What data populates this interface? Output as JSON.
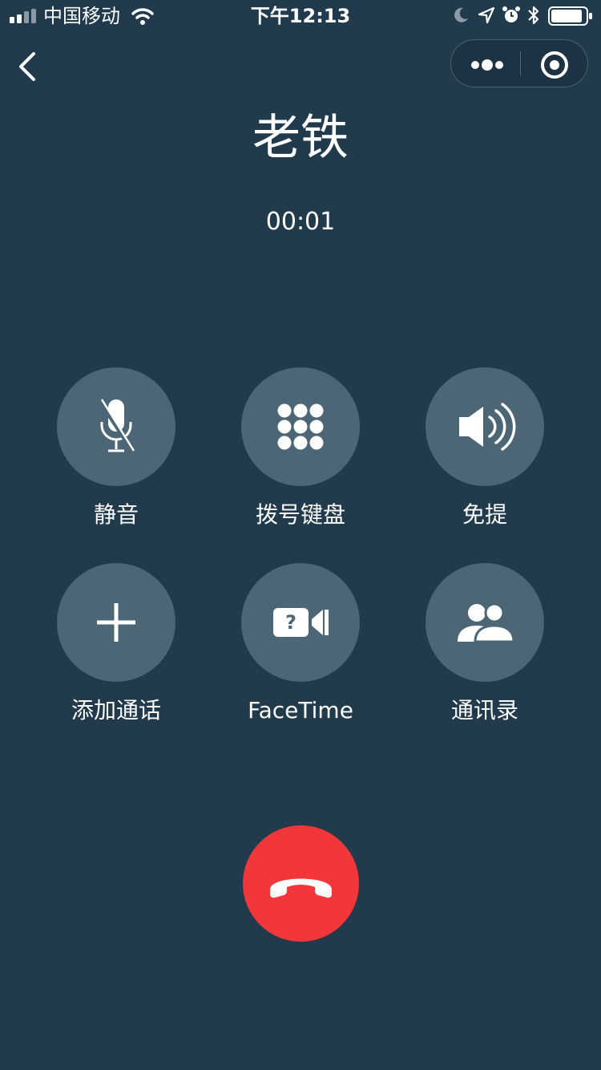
{
  "status_bar": {
    "carrier": "中国移动",
    "time": "下午12:13",
    "icons": [
      "signal-icon",
      "wifi-icon",
      "moon-icon",
      "location-icon",
      "alarm-icon",
      "bluetooth-icon",
      "battery-icon"
    ]
  },
  "nav": {
    "back_icon": "chevron-left-icon",
    "more_icon": "more-dots-icon",
    "close_icon": "target-circle-icon"
  },
  "call": {
    "contact_name": "老铁",
    "timer": "00:01"
  },
  "controls": [
    {
      "label": "静音",
      "icon": "mic-muted-icon"
    },
    {
      "label": "拨号键盘",
      "icon": "keypad-icon"
    },
    {
      "label": "免提",
      "icon": "speaker-icon"
    },
    {
      "label": "添加通话",
      "icon": "plus-icon"
    },
    {
      "label": "FaceTime",
      "icon": "facetime-camera-icon"
    },
    {
      "label": "通讯录",
      "icon": "contacts-icon"
    }
  ],
  "hangup": {
    "icon": "phone-hangup-icon"
  },
  "colors": {
    "background": "#213a4c",
    "button": "#4c6676",
    "hangup": "#f2373a",
    "text": "#ffffff"
  }
}
